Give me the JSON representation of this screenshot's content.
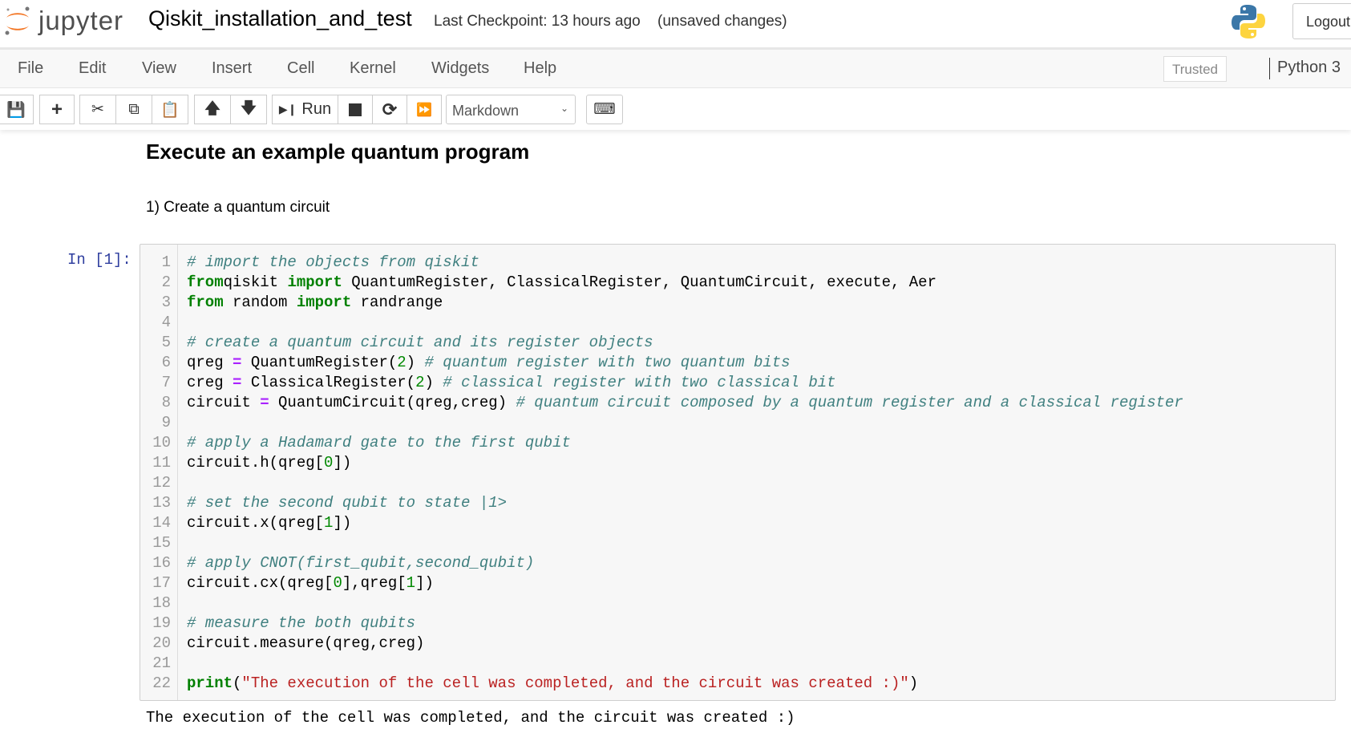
{
  "header": {
    "logo_text": "jupyter",
    "notebook_title": "Qiskit_installation_and_test",
    "checkpoint": "Last Checkpoint: 13 hours ago",
    "unsaved": "(unsaved changes)",
    "logout": "Logout"
  },
  "menubar": {
    "items": [
      "File",
      "Edit",
      "View",
      "Insert",
      "Cell",
      "Kernel",
      "Widgets",
      "Help"
    ],
    "trusted": "Trusted",
    "kernel": "Python 3"
  },
  "toolbar": {
    "run_label": "Run",
    "cell_type": "Markdown"
  },
  "notebook": {
    "heading": "Execute an example quantum program",
    "step": "1) Create a quantum circuit",
    "prompt": "In [1]:",
    "code_lines": [
      [
        [
          "cm",
          "# import the objects from qiskit"
        ]
      ],
      [
        [
          "kw",
          "from"
        ],
        [
          "",
          "qiskit "
        ],
        [
          "kw",
          "import"
        ],
        [
          "",
          " QuantumRegister, ClassicalRegister, QuantumCircuit, execute, Aer"
        ]
      ],
      [
        [
          "kw",
          "from"
        ],
        [
          "",
          " random "
        ],
        [
          "kw",
          "import"
        ],
        [
          "",
          " randrange"
        ]
      ],
      [],
      [
        [
          "cm",
          "# create a quantum circuit and its register objects"
        ]
      ],
      [
        [
          "",
          "qreg "
        ],
        [
          "op",
          "="
        ],
        [
          "",
          " QuantumRegister("
        ],
        [
          "nm",
          "2"
        ],
        [
          "",
          ") "
        ],
        [
          "cm",
          "# quantum register with two quantum bits"
        ]
      ],
      [
        [
          "",
          "creg "
        ],
        [
          "op",
          "="
        ],
        [
          "",
          " ClassicalRegister("
        ],
        [
          "nm",
          "2"
        ],
        [
          "",
          ") "
        ],
        [
          "cm",
          "# classical register with two classical bit"
        ]
      ],
      [
        [
          "",
          "circuit "
        ],
        [
          "op",
          "="
        ],
        [
          "",
          " QuantumCircuit(qreg,creg) "
        ],
        [
          "cm",
          "# quantum circuit composed by a quantum register and a classical register"
        ]
      ],
      [],
      [
        [
          "cm",
          "# apply a Hadamard gate to the first qubit"
        ]
      ],
      [
        [
          "",
          "circuit.h(qreg["
        ],
        [
          "nm",
          "0"
        ],
        [
          "",
          "])"
        ]
      ],
      [],
      [
        [
          "cm",
          "# set the second qubit to state |1>"
        ]
      ],
      [
        [
          "",
          "circuit.x(qreg["
        ],
        [
          "nm",
          "1"
        ],
        [
          "",
          "])"
        ]
      ],
      [],
      [
        [
          "cm",
          "# apply CNOT(first_qubit,second_qubit)"
        ]
      ],
      [
        [
          "",
          "circuit.cx(qreg["
        ],
        [
          "nm",
          "0"
        ],
        [
          "",
          "],qreg["
        ],
        [
          "nm",
          "1"
        ],
        [
          "",
          "])"
        ]
      ],
      [],
      [
        [
          "cm",
          "# measure the both qubits"
        ]
      ],
      [
        [
          "",
          "circuit.measure(qreg,creg)"
        ]
      ],
      [],
      [
        [
          "kw",
          "print"
        ],
        [
          "",
          "("
        ],
        [
          "st",
          "\"The execution of the cell was completed, and the circuit was created :)\""
        ],
        [
          "",
          ")"
        ]
      ]
    ],
    "output": "The execution of the cell was completed, and the circuit was created :)"
  }
}
